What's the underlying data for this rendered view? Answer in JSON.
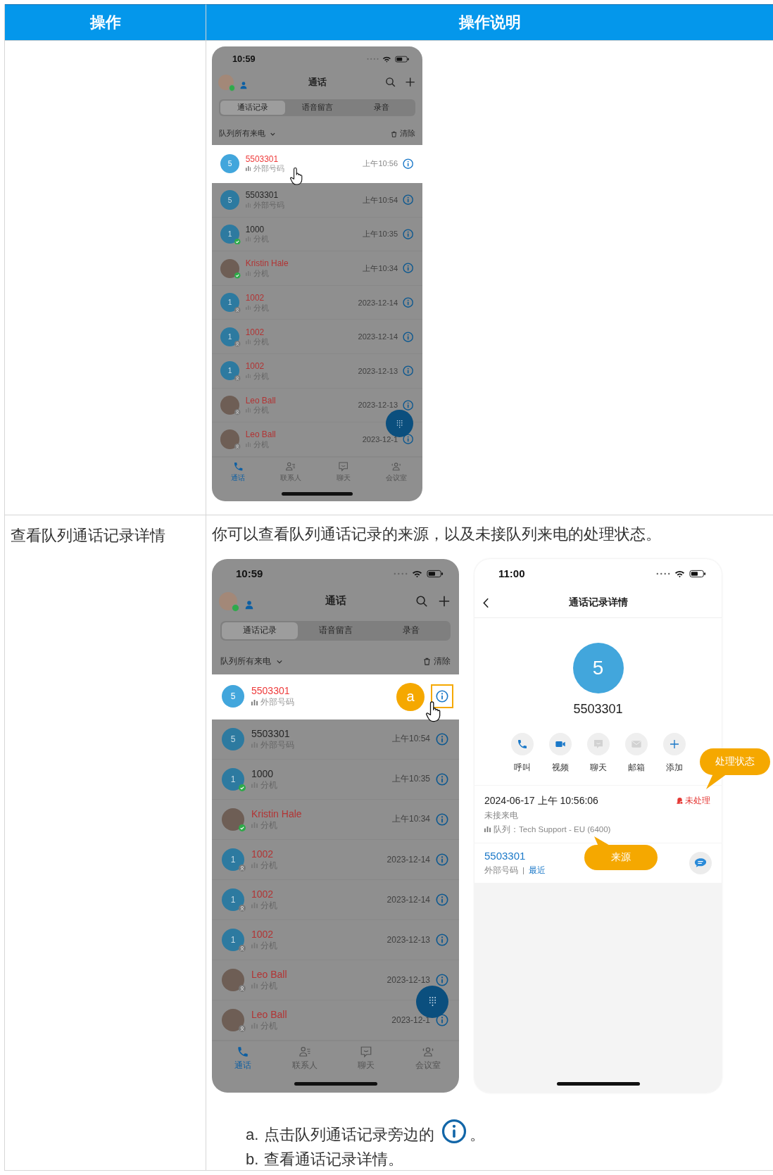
{
  "table": {
    "columns": [
      "操作",
      "操作说明"
    ],
    "rows": [
      {
        "figures": [
          {
            "kind": "call-list",
            "time": "10:59",
            "title": "通话",
            "tabs": [
              {
                "label": "通话记录",
                "selected": true
              },
              {
                "label": "语音留言",
                "selected": false
              },
              {
                "label": "录音",
                "selected": false
              }
            ],
            "filter": "队列所有来电",
            "clear": "清除",
            "calls": [
              {
                "kind": "number",
                "avatar": "5",
                "name": "5503301",
                "type": "外部号码",
                "time": "上午10:56",
                "missed": true,
                "selected": true,
                "pointer": true
              },
              {
                "kind": "number",
                "avatar": "5",
                "name": "5503301",
                "type": "外部号码",
                "time": "上午10:54",
                "missed": false,
                "selected": false
              },
              {
                "kind": "number",
                "avatar": "1",
                "badge": {
                  "kind": "online"
                },
                "name": "1000",
                "type": "分机",
                "time": "上午10:35",
                "missed": false,
                "selected": false
              },
              {
                "kind": "photo",
                "badge": {
                  "kind": "online"
                },
                "name": "Kristin Hale",
                "type": "分机",
                "time": "上午10:34",
                "missed": true,
                "selected": false
              },
              {
                "kind": "number",
                "avatar": "1",
                "badge": {
                  "kind": "offline"
                },
                "name": "1002",
                "type": "分机",
                "time": "2023-12-14",
                "missed": true,
                "selected": false
              },
              {
                "kind": "number",
                "avatar": "1",
                "badge": {
                  "kind": "offline"
                },
                "name": "1002",
                "type": "分机",
                "time": "2023-12-14",
                "missed": true,
                "selected": false
              },
              {
                "kind": "number",
                "avatar": "1",
                "badge": {
                  "kind": "offline"
                },
                "name": "1002",
                "type": "分机",
                "time": "2023-12-13",
                "missed": true,
                "selected": false
              },
              {
                "kind": "photo",
                "badge": {
                  "kind": "offline"
                },
                "name": "Leo Ball",
                "type": "分机",
                "time": "2023-12-13",
                "missed": true,
                "selected": false
              },
              {
                "kind": "photo",
                "badge": {
                  "kind": "offline"
                },
                "name": "Leo Ball",
                "type": "分机",
                "time": "2023-12-1",
                "missed": true,
                "selected": false
              }
            ],
            "nav": [
              {
                "kind": "calls",
                "label": "通话",
                "selected": true
              },
              {
                "kind": "contacts",
                "label": "联系人",
                "selected": false
              },
              {
                "kind": "chat",
                "label": "聊天",
                "selected": false
              },
              {
                "kind": "meeting",
                "label": "会议室",
                "selected": false
              }
            ]
          }
        ]
      },
      {
        "action": "查看队列通话记录详情",
        "description": "你可以查看队列通话记录的来源，以及未接队列来电的处理状态。",
        "figures": [
          {
            "kind": "call-list",
            "time": "10:59",
            "title": "通话",
            "tabs": [
              {
                "label": "通话记录",
                "selected": true
              },
              {
                "label": "语音留言",
                "selected": false
              },
              {
                "label": "录音",
                "selected": false
              }
            ],
            "filter": "队列所有来电",
            "clear": "清除",
            "calls": [
              {
                "kind": "number",
                "avatar": "5",
                "name": "5503301",
                "type": "外部号码",
                "missed": true,
                "selected": true,
                "pointer": true,
                "callout": "a"
              },
              {
                "kind": "number",
                "avatar": "5",
                "name": "5503301",
                "type": "外部号码",
                "time": "上午10:54",
                "missed": false,
                "selected": false
              },
              {
                "kind": "number",
                "avatar": "1",
                "badge": {
                  "kind": "online"
                },
                "name": "1000",
                "type": "分机",
                "time": "上午10:35",
                "missed": false,
                "selected": false
              },
              {
                "kind": "photo",
                "badge": {
                  "kind": "online"
                },
                "name": "Kristin Hale",
                "type": "分机",
                "time": "上午10:34",
                "missed": true,
                "selected": false
              },
              {
                "kind": "number",
                "avatar": "1",
                "badge": {
                  "kind": "offline"
                },
                "name": "1002",
                "type": "分机",
                "time": "2023-12-14",
                "missed": true,
                "selected": false
              },
              {
                "kind": "number",
                "avatar": "1",
                "badge": {
                  "kind": "offline"
                },
                "name": "1002",
                "type": "分机",
                "time": "2023-12-14",
                "missed": true,
                "selected": false
              },
              {
                "kind": "number",
                "avatar": "1",
                "badge": {
                  "kind": "offline"
                },
                "name": "1002",
                "type": "分机",
                "time": "2023-12-13",
                "missed": true,
                "selected": false
              },
              {
                "kind": "photo",
                "badge": {
                  "kind": "offline"
                },
                "name": "Leo Ball",
                "type": "分机",
                "time": "2023-12-13",
                "missed": true,
                "selected": false
              },
              {
                "kind": "photo",
                "badge": {
                  "kind": "offline"
                },
                "name": "Leo Ball",
                "type": "分机",
                "time": "2023-12-1",
                "missed": true,
                "selected": false
              }
            ],
            "nav": [
              {
                "kind": "calls",
                "label": "通话",
                "selected": true
              },
              {
                "kind": "contacts",
                "label": "联系人",
                "selected": false
              },
              {
                "kind": "chat",
                "label": "聊天",
                "selected": false
              },
              {
                "kind": "meeting",
                "label": "会议室",
                "selected": false
              }
            ]
          },
          {
            "kind": "call-detail",
            "time": "11:00",
            "title": "通话记录详情",
            "avatar": "5",
            "number": "5503301",
            "actions": [
              {
                "kind": "call",
                "label": "呼叫",
                "disabled": false
              },
              {
                "kind": "video",
                "label": "视频",
                "disabled": false
              },
              {
                "kind": "chat",
                "label": "聊天",
                "disabled": true
              },
              {
                "kind": "mail",
                "label": "邮箱",
                "disabled": true
              },
              {
                "kind": "add",
                "label": "添加",
                "disabled": false
              }
            ],
            "record": {
              "datetime": "2024-06-17 上午 10:56:06",
              "status": "未处理",
              "result": "未接来电",
              "queue": "队列：Tech Support - EU (6400)"
            },
            "source": {
              "number": "5503301",
              "type": "外部号码",
              "separator": "|",
              "link": "最近"
            },
            "callouts": [
              {
                "kind": "status",
                "text": "处理状态"
              },
              {
                "kind": "source",
                "text": "来源"
              }
            ]
          }
        ],
        "steps": [
          {
            "kind": "with-info-icon",
            "marker": "a.",
            "text": "点击队列通话记录旁边的",
            "after": "。"
          },
          {
            "kind": "plain",
            "marker": "b.",
            "text": "查看通话记录详情。"
          }
        ]
      }
    ]
  }
}
